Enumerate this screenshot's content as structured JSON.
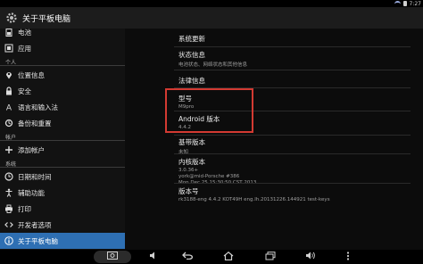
{
  "status_bar": {
    "time": "7:27"
  },
  "action_bar": {
    "title": "关于平板电脑"
  },
  "sidebar": {
    "items": [
      {
        "label": "电池",
        "icon": "battery-icon"
      },
      {
        "label": "应用",
        "icon": "apps-icon"
      },
      {
        "label": "位置信息",
        "icon": "location-icon"
      },
      {
        "label": "安全",
        "icon": "lock-icon"
      },
      {
        "label": "语言和输入法",
        "icon": "language-icon"
      },
      {
        "label": "备份和重置",
        "icon": "backup-icon"
      },
      {
        "label": "添加帐户",
        "icon": "add-icon"
      },
      {
        "label": "日期和时间",
        "icon": "clock-icon"
      },
      {
        "label": "辅助功能",
        "icon": "accessibility-icon"
      },
      {
        "label": "打印",
        "icon": "print-icon"
      },
      {
        "label": "开发者选项",
        "icon": "developer-icon"
      },
      {
        "label": "关于平板电脑",
        "icon": "info-icon"
      }
    ],
    "headers": {
      "personal": "个人",
      "accounts": "帐户",
      "system": "系统"
    }
  },
  "detail": {
    "items": [
      {
        "title": "系统更新",
        "sub": ""
      },
      {
        "title": "状态信息",
        "sub": "电池状态、网络状态和其他信息"
      },
      {
        "title": "法律信息",
        "sub": ""
      },
      {
        "title": "型号",
        "sub": "M9pro"
      },
      {
        "title": "Android 版本",
        "sub": "4.4.2"
      },
      {
        "title": "基带版本",
        "sub": "未知"
      },
      {
        "title": "内核版本",
        "sub_lines": [
          "3.0.36+",
          "york@mid-Porsche #386",
          "Mon Dec 25 15:30:50 CST 2013"
        ]
      },
      {
        "title": "版本号",
        "sub": "rk3188-eng 4.4.2 KOT49H eng.lh.20131226.144921 test-keys"
      }
    ]
  },
  "colors": {
    "accent": "#2e6fb3",
    "highlight": "#d33a32"
  },
  "nav_bar": {
    "icons": [
      "screenshot-icon",
      "volume-down-icon",
      "back-icon",
      "home-icon",
      "recents-icon",
      "volume-up-icon",
      "menu-icon"
    ]
  }
}
